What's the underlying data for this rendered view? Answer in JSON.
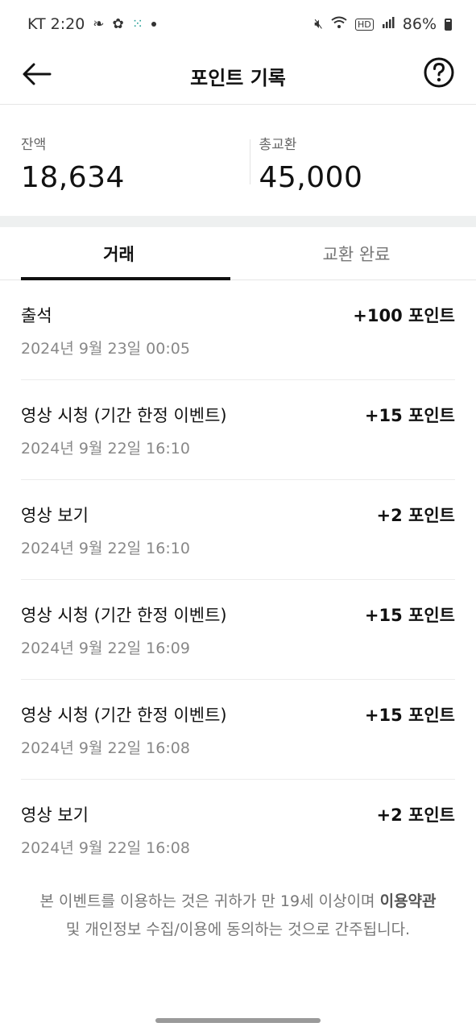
{
  "status_bar": {
    "carrier_time": "KT 2:20",
    "battery": "86%"
  },
  "header": {
    "title": "포인트 기록"
  },
  "summary": {
    "balance_label": "잔액",
    "balance_value": "18,634",
    "total_label": "총교환",
    "total_value": "45,000"
  },
  "tabs": [
    {
      "label": "거래",
      "active": true
    },
    {
      "label": "교환 완료",
      "active": false
    }
  ],
  "transactions": [
    {
      "title": "출석",
      "points": "+100 포인트",
      "date": "2024년 9월 23일 00:05"
    },
    {
      "title": "영상 시청 (기간 한정 이벤트)",
      "points": "+15 포인트",
      "date": "2024년 9월 22일 16:10"
    },
    {
      "title": "영상 보기",
      "points": "+2 포인트",
      "date": "2024년 9월 22일 16:10"
    },
    {
      "title": "영상 시청 (기간 한정 이벤트)",
      "points": "+15 포인트",
      "date": "2024년 9월 22일 16:09"
    },
    {
      "title": "영상 시청 (기간 한정 이벤트)",
      "points": "+15 포인트",
      "date": "2024년 9월 22일 16:08"
    },
    {
      "title": "영상 보기",
      "points": "+2 포인트",
      "date": "2024년 9월 22일 16:08"
    }
  ],
  "notice": {
    "part1": "본 이벤트를 이용하는 것은 귀하가 만 19세 이상이며 ",
    "terms_link": "이용약관",
    "part2": " 및 개인정보 수집/이용에 동의하는 것으로 간주됩니다."
  },
  "icons": {
    "back": "arrow-left-icon",
    "help": "question-circle-icon"
  }
}
